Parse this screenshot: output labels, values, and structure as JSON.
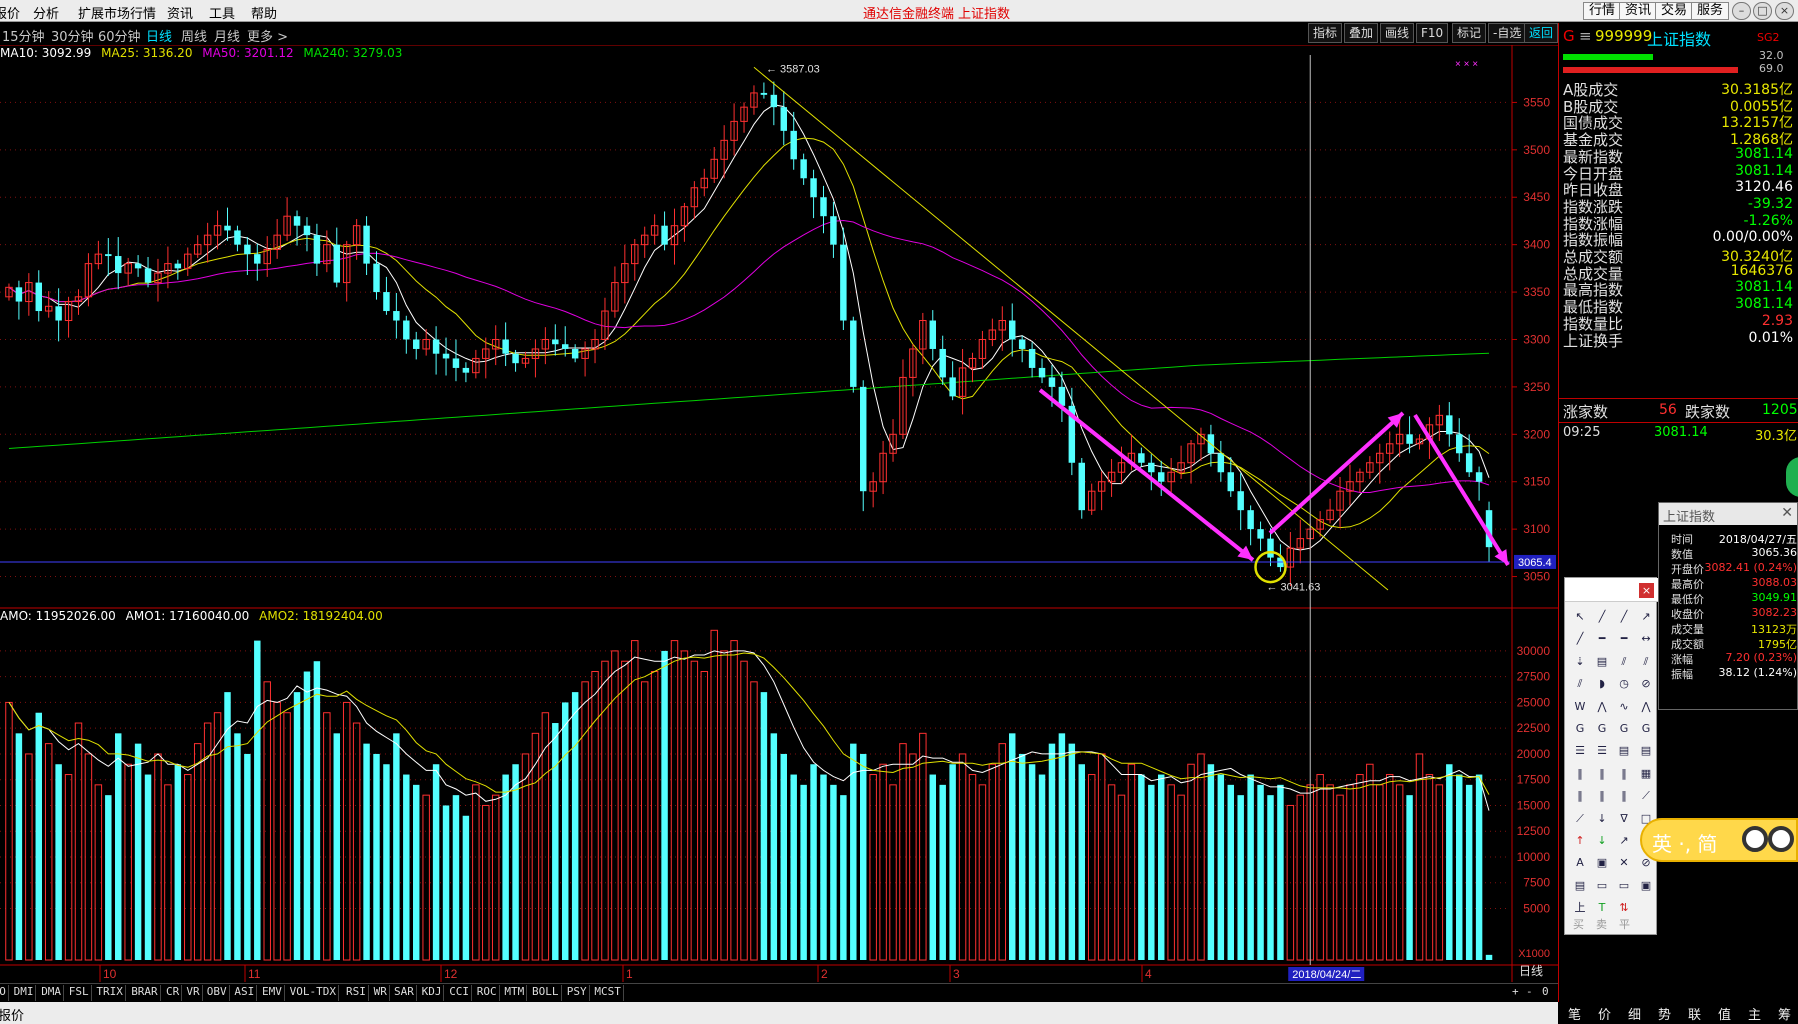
{
  "menubar": {
    "items": [
      "报价",
      "分析",
      "扩展市场行情",
      "资讯",
      "工具",
      "帮助"
    ],
    "title": "通达信金融终端",
    "title2": "上证指数",
    "right_buttons": [
      "行情",
      "资讯",
      "交易",
      "服务"
    ]
  },
  "periodbar": {
    "periods": [
      "15分钟",
      "30分钟",
      "60分钟",
      "日线",
      "周线",
      "月线",
      "更多 >"
    ],
    "active": "日线"
  },
  "toolbar_right": [
    "指标",
    "叠加",
    "画线",
    "F10",
    "标记",
    "-自选",
    "返回"
  ],
  "ma_legend": [
    {
      "text": "MA10: 3092.99",
      "color": "#ffffff"
    },
    {
      "text": "MA25: 3136.20",
      "color": "#e0e000"
    },
    {
      "text": "MA50: 3201.12",
      "color": "#e000e0"
    },
    {
      "text": "MA240: 3279.03",
      "color": "#00e000"
    }
  ],
  "amo_legend": [
    {
      "text": "AMO: 11952026.00",
      "color": "#ffffff"
    },
    {
      "text": "AMO1: 17160040.00",
      "color": "#ffffff"
    },
    {
      "text": "AMO2: 18192404.00",
      "color": "#e0e000"
    }
  ],
  "chart_data": [
    {
      "type": "candlestick",
      "title": "上证指数 日线",
      "ylim": [
        3020,
        3600
      ],
      "y_ticks": [
        3050,
        3100,
        3150,
        3200,
        3250,
        3300,
        3350,
        3400,
        3450,
        3500,
        3550
      ],
      "x_month_labels": [
        "10",
        "11",
        "12",
        "1",
        "2",
        "3",
        "4"
      ],
      "cursor_date": "2018/04/24/二",
      "cursor_price_label": "3065.4",
      "annotations": [
        "3587.03",
        "3041.63"
      ],
      "high_point": 3587.03,
      "low_point": 3041.63,
      "ma_values": {
        "MA10": 3092.99,
        "MA25": 3136.2,
        "MA50": 3201.12,
        "MA240": 3279.03
      },
      "close_series": [
        3355,
        3340,
        3360,
        3330,
        3335,
        3320,
        3340,
        3345,
        3380,
        3390,
        3388,
        3370,
        3380,
        3375,
        3360,
        3370,
        3380,
        3375,
        3390,
        3400,
        3410,
        3420,
        3415,
        3400,
        3390,
        3380,
        3395,
        3410,
        3430,
        3420,
        3410,
        3380,
        3400,
        3360,
        3400,
        3420,
        3380,
        3350,
        3330,
        3320,
        3300,
        3290,
        3300,
        3285,
        3280,
        3270,
        3265,
        3280,
        3290,
        3300,
        3285,
        3275,
        3280,
        3290,
        3300,
        3295,
        3290,
        3280,
        3290,
        3300,
        3330,
        3360,
        3380,
        3400,
        3410,
        3420,
        3400,
        3420,
        3440,
        3460,
        3470,
        3490,
        3510,
        3530,
        3545,
        3560,
        3558,
        3545,
        3520,
        3490,
        3470,
        3450,
        3430,
        3400,
        3320,
        3250,
        3140,
        3150,
        3180,
        3200,
        3260,
        3290,
        3320,
        3290,
        3260,
        3240,
        3270,
        3280,
        3300,
        3310,
        3320,
        3300,
        3290,
        3270,
        3260,
        3250,
        3230,
        3170,
        3120,
        3140,
        3150,
        3160,
        3170,
        3180,
        3170,
        3160,
        3150,
        3160,
        3170,
        3190,
        3200,
        3180,
        3160,
        3140,
        3120,
        3100,
        3090,
        3070,
        3060,
        3080,
        3090,
        3100,
        3110,
        3120,
        3140,
        3150,
        3160,
        3170,
        3180,
        3190,
        3200,
        3190,
        3195,
        3210,
        3220,
        3200,
        3180,
        3160,
        3150,
        3081
      ],
      "open_series": [
        3345,
        3355,
        3340,
        3360,
        3330,
        3335,
        3320,
        3340,
        3345,
        3380,
        3390,
        3388,
        3370,
        3380,
        3375,
        3360,
        3370,
        3380,
        3375,
        3390,
        3400,
        3410,
        3420,
        3415,
        3400,
        3390,
        3380,
        3395,
        3410,
        3430,
        3420,
        3410,
        3380,
        3400,
        3360,
        3400,
        3420,
        3380,
        3350,
        3330,
        3320,
        3300,
        3290,
        3300,
        3285,
        3280,
        3270,
        3265,
        3280,
        3290,
        3300,
        3285,
        3275,
        3280,
        3290,
        3300,
        3295,
        3290,
        3280,
        3290,
        3300,
        3330,
        3360,
        3380,
        3400,
        3410,
        3420,
        3400,
        3420,
        3440,
        3460,
        3470,
        3490,
        3510,
        3530,
        3545,
        3560,
        3558,
        3545,
        3520,
        3490,
        3470,
        3450,
        3430,
        3400,
        3320,
        3250,
        3140,
        3150,
        3180,
        3200,
        3260,
        3290,
        3320,
        3290,
        3260,
        3240,
        3270,
        3280,
        3300,
        3310,
        3320,
        3300,
        3290,
        3270,
        3260,
        3250,
        3230,
        3170,
        3120,
        3140,
        3150,
        3160,
        3170,
        3180,
        3170,
        3160,
        3150,
        3160,
        3170,
        3190,
        3200,
        3180,
        3160,
        3140,
        3120,
        3100,
        3090,
        3070,
        3060,
        3080,
        3090,
        3100,
        3110,
        3120,
        3140,
        3150,
        3160,
        3170,
        3180,
        3190,
        3200,
        3190,
        3195,
        3210,
        3220,
        3200,
        3180,
        3160,
        3120
      ]
    },
    {
      "type": "bar",
      "title": "AMO",
      "ylim": [
        0,
        33000
      ],
      "y_ticks": [
        5000,
        7500,
        10000,
        12500,
        15000,
        17500,
        20000,
        22500,
        25000,
        27500,
        30000
      ],
      "unit_label": "X1000",
      "period_label": "日线",
      "values": [
        25000,
        22000,
        20000,
        24000,
        21000,
        19000,
        18000,
        23000,
        20000,
        17000,
        16000,
        22000,
        19000,
        21000,
        18000,
        20000,
        17000,
        19000,
        18000,
        21000,
        23000,
        24000,
        26000,
        22000,
        20000,
        31000,
        27000,
        25000,
        24000,
        26000,
        28000,
        29000,
        24000,
        22000,
        25000,
        23000,
        21000,
        20000,
        19000,
        22000,
        18000,
        17000,
        16000,
        19000,
        15000,
        16000,
        14000,
        17000,
        15000,
        16000,
        18000,
        19000,
        20000,
        22000,
        24000,
        23000,
        25000,
        26000,
        27000,
        28000,
        29000,
        30000,
        29000,
        31000,
        27000,
        28000,
        30000,
        31000,
        30000,
        29000,
        28000,
        32000,
        30000,
        31000,
        29000,
        27000,
        26000,
        22000,
        20000,
        18000,
        17000,
        19000,
        18000,
        17000,
        16000,
        21000,
        20000,
        18000,
        19000,
        17000,
        21000,
        20000,
        22000,
        18000,
        17000,
        19000,
        20000,
        18000,
        17000,
        19000,
        21000,
        22000,
        20000,
        19000,
        18000,
        21000,
        22000,
        21000,
        19000,
        18000,
        20000,
        17000,
        16000,
        19000,
        18000,
        17000,
        18000,
        17000,
        16000,
        19000,
        20000,
        19000,
        18000,
        17000,
        16000,
        18000,
        17000,
        16000,
        17000,
        15000,
        16000,
        17000,
        18000,
        17000,
        16000,
        17000,
        18000,
        19000,
        17000,
        18000,
        17000,
        16000,
        20000,
        18000,
        17000,
        19000,
        18000,
        17000,
        18000,
        500
      ]
    }
  ],
  "right_panel": {
    "code": "999999",
    "name": "上证指数",
    "tag": "SG2",
    "bar1_value": "32.0",
    "bar2_value": "69.0",
    "rows": [
      {
        "label": "A股成交",
        "value": "30.3185亿",
        "color": "#e8e800"
      },
      {
        "label": "B股成交",
        "value": "0.0055亿",
        "color": "#e8e800"
      },
      {
        "label": "国债成交",
        "value": "13.2157亿",
        "color": "#e8e800"
      },
      {
        "label": "基金成交",
        "value": "1.2868亿",
        "color": "#e8e800"
      },
      {
        "label": "最新指数",
        "value": "3081.14",
        "color": "#00ff00"
      },
      {
        "label": "今日开盘",
        "value": "3081.14",
        "color": "#00ff00"
      },
      {
        "label": "昨日收盘",
        "value": "3120.46",
        "color": "#ffffff"
      },
      {
        "label": "指数涨跌",
        "value": "-39.32",
        "color": "#00ff00"
      },
      {
        "label": "指数涨幅",
        "value": "-1.26%",
        "color": "#00ff00"
      },
      {
        "label": "指数振幅",
        "value": "0.00/0.00%",
        "color": "#ffffff"
      },
      {
        "label": "总成交额",
        "value": "30.3240亿",
        "color": "#e8e800"
      },
      {
        "label": "总成交量",
        "value": "1646376",
        "color": "#e8e800"
      },
      {
        "label": "最高指数",
        "value": "3081.14",
        "color": "#00ff00"
      },
      {
        "label": "最低指数",
        "value": "3081.14",
        "color": "#00ff00"
      },
      {
        "label": "指数量比",
        "value": "2.93",
        "color": "#ff3030"
      },
      {
        "label": "上证换手",
        "value": "0.01%",
        "color": "#ffffff"
      }
    ],
    "up_label": "涨家数",
    "up_value": "56",
    "down_label": "跌家数",
    "down_value": "1205",
    "time": "09:25",
    "time_price": "3081.14",
    "time_vol": "30.3亿"
  },
  "info_box": {
    "title": "上证指数",
    "rows": [
      {
        "label": "时间",
        "value": "2018/04/27/五",
        "color": "#ffffff"
      },
      {
        "label": "数值",
        "value": "3065.36",
        "color": "#ffffff"
      },
      {
        "label": "开盘价",
        "value": "3082.41 (0.24%)",
        "color": "#ff3030"
      },
      {
        "label": "最高价",
        "value": "3088.03",
        "color": "#ff3030"
      },
      {
        "label": "最低价",
        "value": "3049.91",
        "color": "#00ff00"
      },
      {
        "label": "收盘价",
        "value": "3082.23",
        "color": "#ff3030"
      },
      {
        "label": "成交量",
        "value": "13123万",
        "color": "#e8e800"
      },
      {
        "label": "成交额",
        "value": "1795亿",
        "color": "#e8e800"
      },
      {
        "label": "涨幅",
        "value": "7.20 (0.23%)",
        "color": "#ff3030"
      },
      {
        "label": "振幅",
        "value": "38.12 (1.24%)",
        "color": "#ffffff"
      }
    ]
  },
  "drawtools": {
    "close": "×",
    "labels": [
      "买",
      "卖",
      "平"
    ]
  },
  "ime": {
    "text": "英 ·, 简"
  },
  "bottom_tabs": [
    "AMO",
    "DMI",
    "DMA",
    "FSL",
    "TRIX",
    "BRAR",
    "CR",
    "VR",
    "OBV",
    "ASI",
    "EMV",
    "VOL-TDX",
    "RSI",
    "WR",
    "SAR",
    "KDJ",
    "CCI",
    "ROC",
    "MTM",
    "BOLL",
    "PSY",
    "MCST"
  ],
  "bottom_tabs_right": [
    "+",
    "-",
    "0"
  ],
  "statusbar": {
    "left": "报价"
  },
  "right_bottom_tabs": [
    "笔",
    "价",
    "细",
    "势",
    "联",
    "值",
    "主",
    "筹"
  ]
}
